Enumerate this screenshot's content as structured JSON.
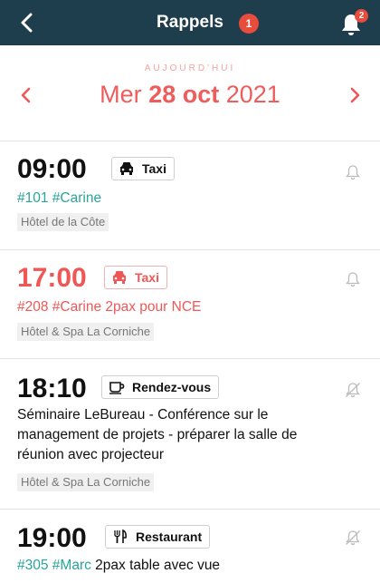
{
  "header": {
    "title": "Rappels",
    "title_badge": "1",
    "bell_badge": "2"
  },
  "date_nav": {
    "today_label": "AUJOURD'HUI",
    "weekday": "Mer",
    "day_month": "28 oct",
    "year": "2021"
  },
  "reminders": [
    {
      "time": "09:00",
      "category": "Taxi",
      "category_icon": "taxi-icon",
      "tags": "#101 #Carine",
      "note": "",
      "place": "Hôtel de la Côte",
      "bell": "bell-icon"
    },
    {
      "time": "17:00",
      "category": "Taxi",
      "category_icon": "taxi-icon",
      "tags": "#208 #Carine",
      "note": " 2pax pour NCE",
      "place": "Hôtel & Spa La Corniche",
      "bell": "bell-icon"
    },
    {
      "time": "18:10",
      "category": "Rendez-vous",
      "category_icon": "coffee-cup-icon",
      "note_lines": [
        "Séminaire LeBureau - Conférence sur le",
        "management de projets - préparer la salle de",
        "réunion avec projecteur"
      ],
      "place": "Hôtel & Spa La Corniche",
      "bell": "bell-off-icon"
    },
    {
      "time": "19:00",
      "category": "Restaurant",
      "category_icon": "fork-knife-icon",
      "tag_room": "#305",
      "tag_name": "#Marc",
      "note": " 2pax table avec vue",
      "bell": "bell-off-icon"
    }
  ],
  "colors": {
    "header_bg": "#1f3e4d",
    "accent_red": "#ef5757",
    "tag_teal": "#27a59a"
  }
}
